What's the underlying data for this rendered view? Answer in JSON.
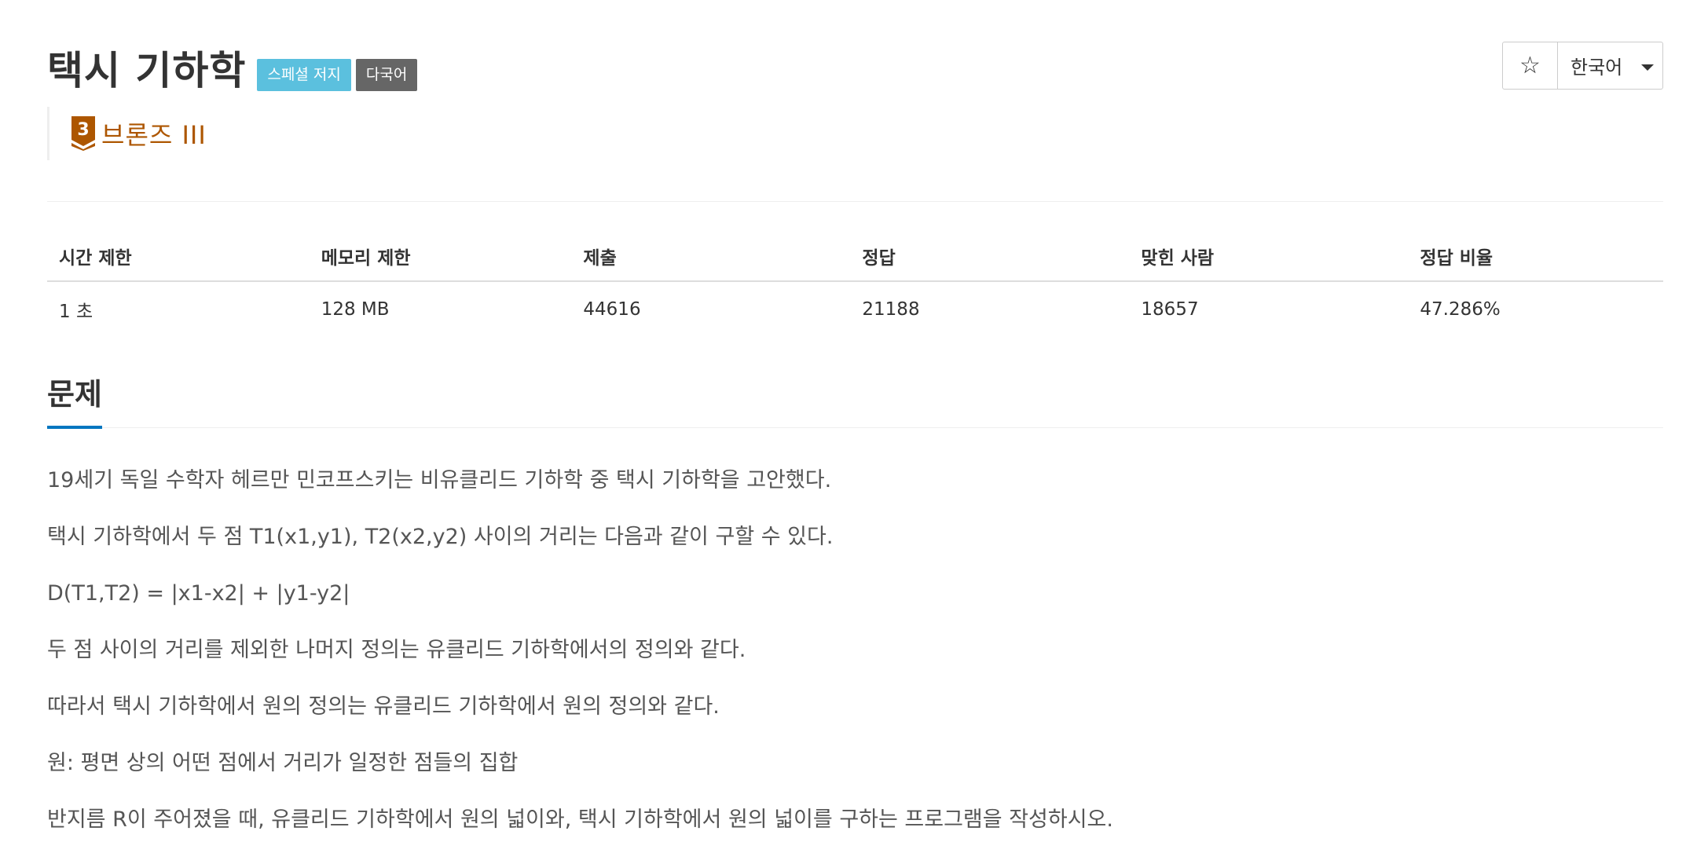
{
  "header": {
    "title": "택시 기하학",
    "labels": {
      "special_judge": "스페셜 저지",
      "multilang": "다국어"
    },
    "star_icon": "star-outline-icon",
    "language_select": "한국어"
  },
  "tier": {
    "level_number": "3",
    "text": "브론즈 III",
    "color": "#ad5600"
  },
  "info_table": {
    "headers": [
      "시간 제한",
      "메모리 제한",
      "제출",
      "정답",
      "맞힌 사람",
      "정답 비율"
    ],
    "values": [
      "1 초",
      "128 MB",
      "44616",
      "21188",
      "18657",
      "47.286%"
    ]
  },
  "section": {
    "title": "문제",
    "accent_color": "#0076c0"
  },
  "description": [
    "19세기 독일 수학자 헤르만 민코프스키는 비유클리드 기하학 중 택시 기하학을 고안했다.",
    "택시 기하학에서 두 점 T1(x1,y1), T2(x2,y2) 사이의 거리는 다음과 같이 구할 수 있다.",
    "D(T1,T2) = |x1-x2| + |y1-y2|",
    "두 점 사이의 거리를 제외한 나머지 정의는 유클리드 기하학에서의 정의와 같다.",
    "따라서 택시 기하학에서 원의 정의는 유클리드 기하학에서 원의 정의와 같다.",
    "원: 평면 상의 어떤 점에서 거리가 일정한 점들의 집합",
    "반지름 R이 주어졌을 때, 유클리드 기하학에서 원의 넓이와, 택시 기하학에서 원의 넓이를 구하는 프로그램을 작성하시오."
  ]
}
